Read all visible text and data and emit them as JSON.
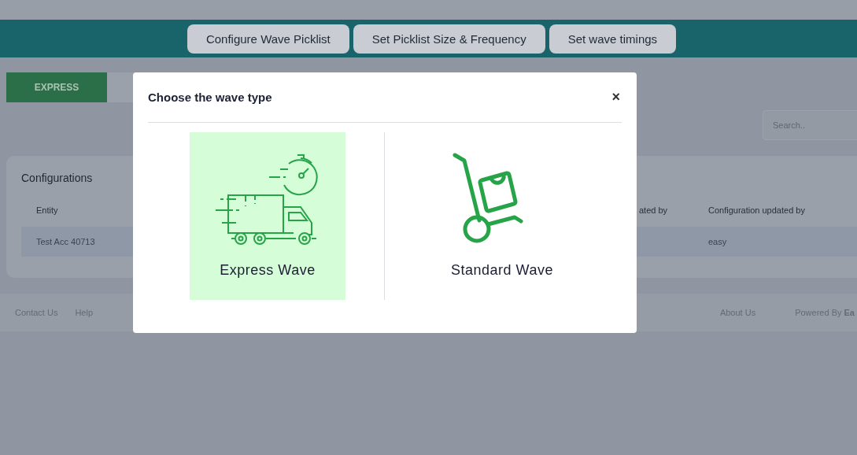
{
  "header_tabs": [
    {
      "label": "Configure Wave Picklist"
    },
    {
      "label": "Set Picklist Size & Frequency"
    },
    {
      "label": "Set wave timings"
    }
  ],
  "wave_tabs": [
    {
      "label": "EXPRESS",
      "selected": true
    }
  ],
  "search": {
    "placeholder": "Search.."
  },
  "configurations": {
    "title": "Configurations",
    "columns": [
      "Entity",
      "ated by",
      "Configuration updated by"
    ],
    "rows": [
      {
        "entity": "Test Acc 40713",
        "configuration_updated_by": "easy"
      }
    ]
  },
  "footer": {
    "links": [
      "Contact Us",
      "Help",
      "About Us"
    ],
    "powered_by": "Powered By **Ea**"
  },
  "modal": {
    "title": "Choose the wave type",
    "close": "×",
    "options": [
      {
        "label": "Express Wave",
        "kind": "express",
        "selected": true
      },
      {
        "label": "Standard Wave",
        "kind": "standard",
        "selected": false
      }
    ]
  }
}
